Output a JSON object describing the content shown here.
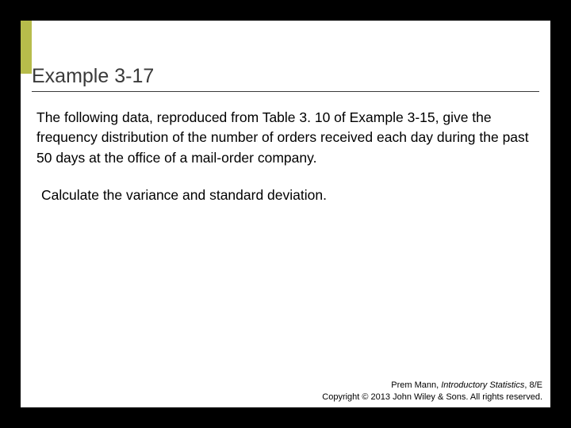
{
  "title": "Example 3-17",
  "paragraph1": "The following data, reproduced from Table 3. 10 of Example 3-15, give the frequency distribution of the number of orders received each day during the past 50 days at the office of a mail-order company.",
  "paragraph2": "Calculate the variance and standard deviation.",
  "footer": {
    "author": "Prem Mann, ",
    "book": "Introductory Statistics",
    "edition": ", 8/E",
    "copyright": "Copyright © 2013 John Wiley & Sons. All rights reserved."
  }
}
